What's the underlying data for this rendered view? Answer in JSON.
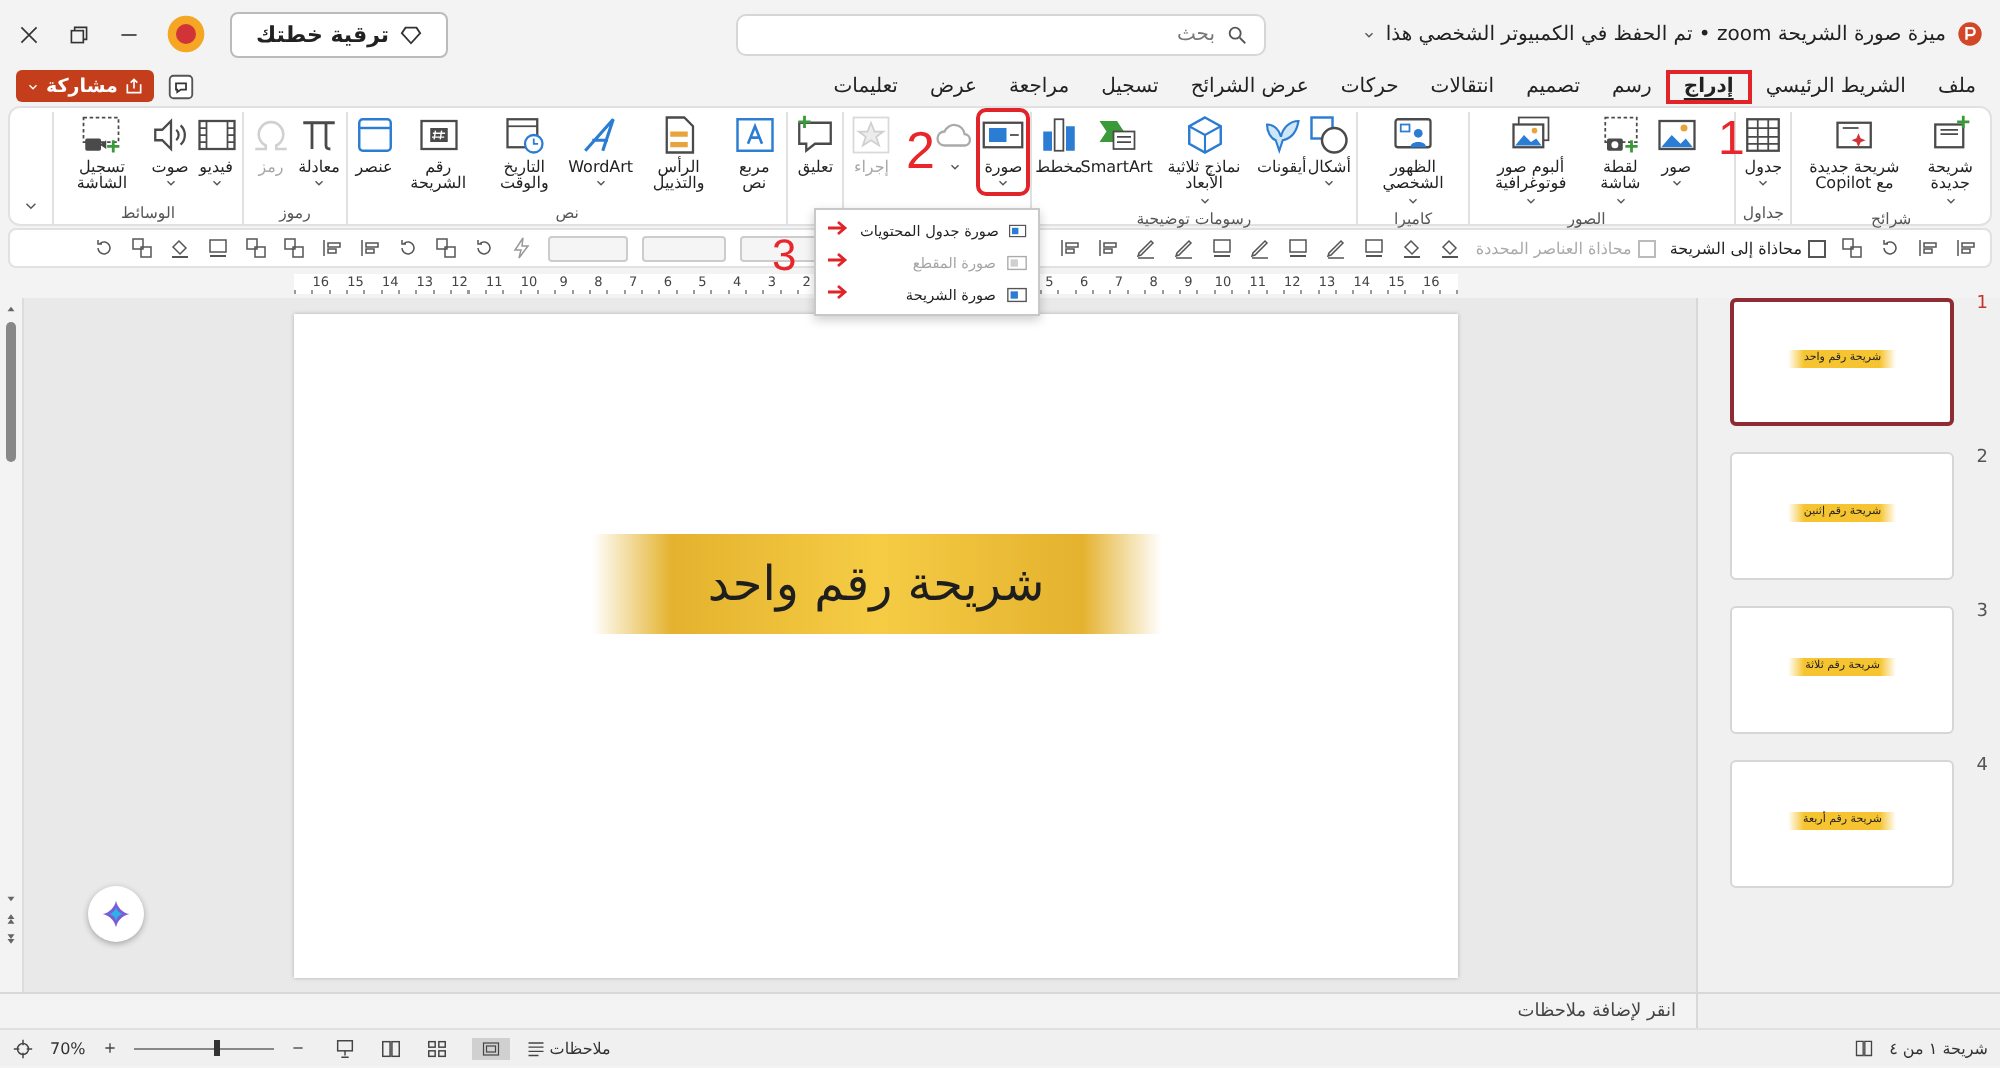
{
  "title_bar": {
    "title": "ميزة صورة الشريحة zoom • تم الحفظ في الكمبيوتر الشخصي هذا",
    "search": {
      "placeholder": "بحث"
    },
    "upgrade_button": "ترقية خطتك"
  },
  "tabs": [
    {
      "label": "ملف",
      "selected": false,
      "highlighted": false
    },
    {
      "label": "الشريط الرئيسي",
      "selected": false,
      "highlighted": false
    },
    {
      "label": "إدراج",
      "selected": true,
      "highlighted": true
    },
    {
      "label": "رسم",
      "selected": false,
      "highlighted": false
    },
    {
      "label": "تصميم",
      "selected": false,
      "highlighted": false
    },
    {
      "label": "انتقالات",
      "selected": false,
      "highlighted": false
    },
    {
      "label": "حركات",
      "selected": false,
      "highlighted": false
    },
    {
      "label": "عرض الشرائح",
      "selected": false,
      "highlighted": false
    },
    {
      "label": "تسجيل",
      "selected": false,
      "highlighted": false
    },
    {
      "label": "مراجعة",
      "selected": false,
      "highlighted": false
    },
    {
      "label": "عرض",
      "selected": false,
      "highlighted": false
    },
    {
      "label": "تعليمات",
      "selected": false,
      "highlighted": false
    }
  ],
  "share_button": "مشاركة",
  "ribbon": {
    "groups": [
      {
        "label": "شرائح",
        "buttons": [
          {
            "label": "شريحة جديدة",
            "dropdown": true,
            "disabled": false,
            "highlighted": false
          },
          {
            "label": "شريحة جديدة مع Copilot",
            "dropdown": false,
            "disabled": false,
            "highlighted": false
          }
        ]
      },
      {
        "label": "جداول",
        "buttons": [
          {
            "label": "جدول",
            "dropdown": true,
            "disabled": false,
            "highlighted": false
          }
        ]
      },
      {
        "label": "الصور",
        "buttons": [
          {
            "label": "صور",
            "dropdown": true,
            "disabled": false,
            "highlighted": false
          },
          {
            "label": "لقطة شاشة",
            "dropdown": true,
            "disabled": false,
            "highlighted": false
          },
          {
            "label": "ألبوم صور فوتوغرافية",
            "dropdown": true,
            "disabled": false,
            "highlighted": false
          }
        ]
      },
      {
        "label": "كاميرا",
        "buttons": [
          {
            "label": "الظهور الشخصي",
            "dropdown": true,
            "disabled": false,
            "highlighted": false
          }
        ]
      },
      {
        "label": "رسومات توضيحية",
        "buttons": [
          {
            "label": "أشكال",
            "dropdown": true,
            "disabled": false,
            "highlighted": false
          },
          {
            "label": "أيقونات",
            "dropdown": false,
            "disabled": false,
            "highlighted": false
          },
          {
            "label": "نماذج ثلاثية الأبعاد",
            "dropdown": true,
            "disabled": false,
            "highlighted": false
          },
          {
            "label": "SmartArt",
            "dropdown": false,
            "disabled": false,
            "highlighted": false
          },
          {
            "label": "مخطط",
            "dropdown": false,
            "disabled": false,
            "highlighted": false
          }
        ]
      },
      {
        "buttons": [
          {
            "label": "صورة",
            "dropdown": true,
            "disabled": false,
            "highlighted": true
          },
          {
            "dropdown": true,
            "disabled": false,
            "highlighted": false
          },
          {
            "label": "إجراء",
            "dropdown": false,
            "disabled": true,
            "highlighted": false
          }
        ]
      },
      {
        "buttons": [
          {
            "label": "تعليق",
            "dropdown": false,
            "disabled": false,
            "highlighted": false
          }
        ]
      },
      {
        "label": "نص",
        "buttons": [
          {
            "label": "مربع نص",
            "dropdown": false,
            "disabled": false,
            "highlighted": false
          },
          {
            "label": "الرأس والتذييل",
            "dropdown": false,
            "disabled": false,
            "highlighted": false
          },
          {
            "label": "WordArt",
            "dropdown": true,
            "disabled": false,
            "highlighted": false
          },
          {
            "label": "التاريخ والوقت",
            "dropdown": false,
            "disabled": false,
            "highlighted": false
          },
          {
            "label": "رقم الشريحة",
            "dropdown": false,
            "disabled": false,
            "highlighted": false
          },
          {
            "label": "عنصر",
            "dropdown": false,
            "disabled": false,
            "highlighted": false
          }
        ]
      },
      {
        "label": "رموز",
        "buttons": [
          {
            "label": "معادلة",
            "dropdown": true,
            "disabled": false,
            "highlighted": false
          },
          {
            "label": "رمز",
            "dropdown": false,
            "disabled": true,
            "highlighted": false
          }
        ]
      },
      {
        "label": "الوسائط",
        "buttons": [
          {
            "label": "فيديو",
            "dropdown": true,
            "disabled": false,
            "highlighted": false
          },
          {
            "label": "صوت",
            "dropdown": true,
            "disabled": false,
            "highlighted": false
          },
          {
            "label": "تسجيل الشاشة",
            "dropdown": false,
            "disabled": false,
            "highlighted": false
          }
        ]
      }
    ]
  },
  "menu": {
    "items": [
      {
        "label": "صورة جدول المحتويات",
        "disabled": false
      },
      {
        "label": "صورة المقطع",
        "disabled": true
      },
      {
        "label": "صورة الشريحة",
        "disabled": false
      }
    ]
  },
  "drawing_toolbar": {
    "checkboxes": [
      {
        "label": "محاذاة إلى الشريحة",
        "checked": false,
        "disabled": false
      },
      {
        "label": "محاذاة العناصر المحددة",
        "checked": false,
        "disabled": true
      }
    ]
  },
  "ruler": {
    "numbers": [
      "16",
      "15",
      "14",
      "13",
      "12",
      "11",
      "10",
      "9",
      "8",
      "7",
      "6",
      "5",
      "2",
      "3",
      "4",
      "5",
      "6",
      "7",
      "8",
      "9",
      "10",
      "11",
      "12",
      "13",
      "14",
      "15",
      "16"
    ]
  },
  "slide": {
    "title": "شريحة رقم واحد"
  },
  "thumbnails": [
    {
      "number": "1",
      "title": "شريحة رقم واحد",
      "selected": true
    },
    {
      "number": "2",
      "title": "شريحة رقم إثنين",
      "selected": false
    },
    {
      "number": "3",
      "title": "شريحة رقم ثلاثة",
      "selected": false
    },
    {
      "number": "4",
      "title": "شريحة رقم أربعة",
      "selected": false
    }
  ],
  "notes": {
    "placeholder": "انقر لإضافة ملاحظات"
  },
  "status_bar": {
    "slide_info": "شريحة ١ من ٤",
    "notes_button": "ملاحظات",
    "zoom_percent": "70%"
  },
  "annotations": [
    {
      "label": "1"
    },
    {
      "label": "2"
    },
    {
      "label": "3"
    }
  ]
}
